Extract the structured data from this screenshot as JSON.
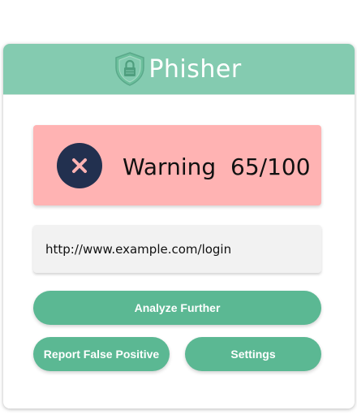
{
  "app": {
    "name": "Phisher",
    "logo_icon": "shield-lock-icon",
    "header_color": "#84cbb0",
    "accent_color": "#5bb893"
  },
  "warning": {
    "icon": "close-icon",
    "label": "Warning",
    "score": "65/100",
    "background": "#ffb3b3"
  },
  "url": {
    "value": "http://www.example.com/login"
  },
  "actions": {
    "analyze": "Analyze Further",
    "report": "Report False Positive",
    "settings": "Settings"
  }
}
